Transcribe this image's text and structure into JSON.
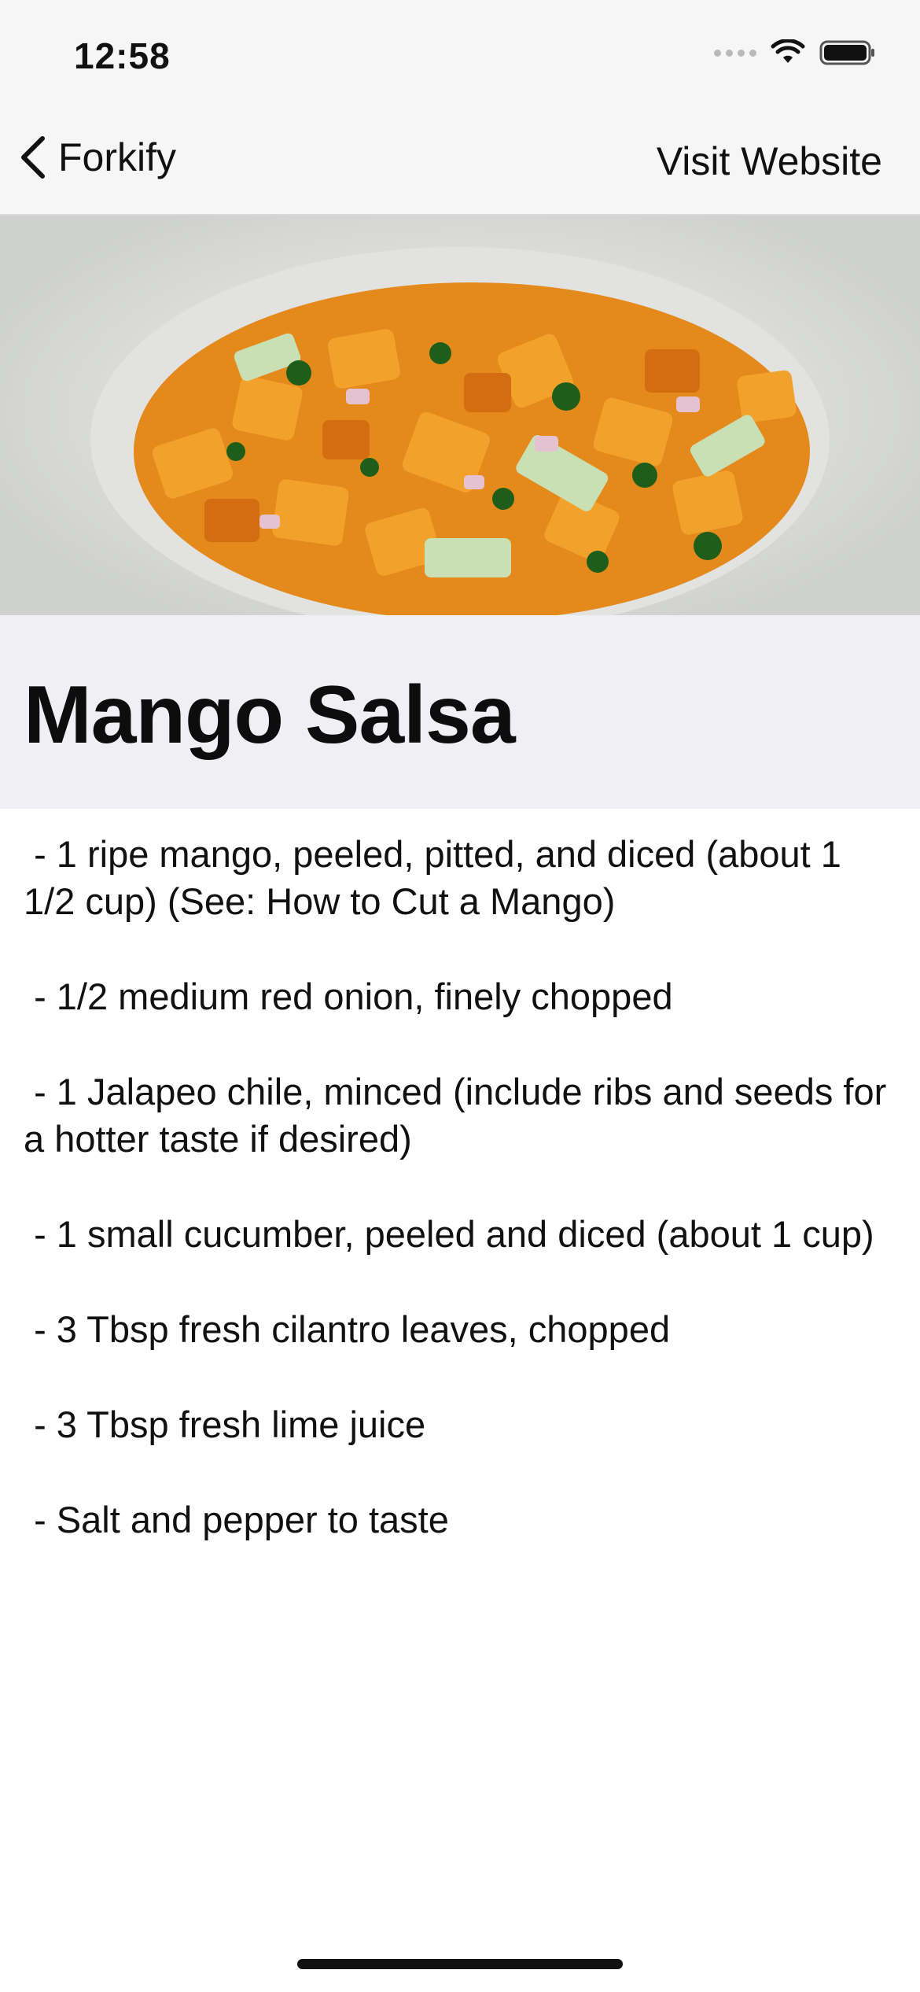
{
  "status_bar": {
    "time": "12:58"
  },
  "nav": {
    "back_label": "Forkify",
    "right_action": "Visit Website"
  },
  "hero": {
    "description": "Mango salsa in a white bowl"
  },
  "recipe": {
    "title": "Mango Salsa",
    "ingredients": [
      " - 1 ripe mango, peeled, pitted, and diced (about 1 1/2 cup) (See: How to Cut a Mango)",
      " - 1/2 medium red onion, finely chopped",
      " - 1 Jalapeo chile, minced (include ribs and seeds for a hotter taste if desired)",
      " - 1 small cucumber, peeled and diced (about 1 cup)",
      " - 3 Tbsp fresh cilantro leaves, chopped",
      " - 3 Tbsp fresh lime juice",
      " - Salt and pepper to taste"
    ]
  },
  "icons": {
    "back": "chevron-left-icon",
    "wifi": "wifi-icon",
    "battery": "battery-icon",
    "signal": "signal-icon"
  },
  "colors": {
    "nav_background": "#f6f6f6",
    "title_band": "#f0f0f4",
    "text": "#111111"
  }
}
